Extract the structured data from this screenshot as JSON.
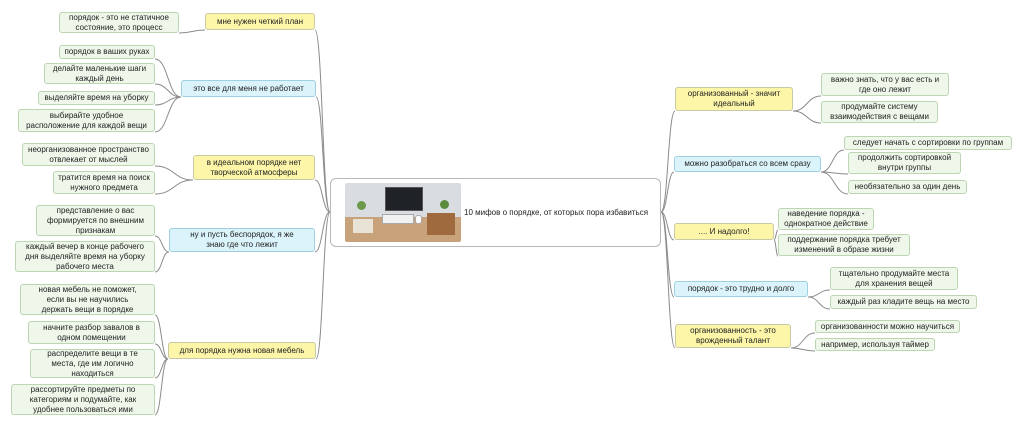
{
  "center": {
    "title": "10 мифов о порядке, от которых пора избавиться",
    "image_icon": "desk-photo"
  },
  "left": [
    {
      "label": "мне нужен четкий план",
      "color": "yellow",
      "children": [
        "порядок - это не статичное\nсостояние, это процесс"
      ]
    },
    {
      "label": "это все для меня не работает",
      "color": "blue",
      "children": [
        "порядок в ваших руках",
        "делайте маленькие шаги\nкаждый день",
        "выделяйте время на уборку",
        "выбирайте удобное\nрасположение для каждой вещи"
      ]
    },
    {
      "label": "в идеальном порядке нет\nтворческой атмосферы",
      "color": "yellow",
      "children": [
        "неорганизованное пространство\nотвлекает от мыслей",
        "тратится время на поиск\nнужного предмета"
      ]
    },
    {
      "label": "ну и пусть беспорядок, я же\nзнаю где что лежит",
      "color": "blue",
      "children": [
        "представление о вас\nформируется по внешним\nпризнакам",
        "каждый вечер в конце рабочего\nдня выделяйте время на уборку\nрабочего места"
      ]
    },
    {
      "label": "для порядка нужна новая мебель",
      "color": "yellow",
      "children": [
        "новая мебель не поможет,\nесли вы не научились\nдержать вещи в порядке",
        "начните разбор завалов в\nодном помещении",
        "распределите вещи в те\nместа, где им логично\nнаходиться",
        "рассортируйте предметы по\nкатегориям и подумайте, как\nудобнее пользоваться ими"
      ]
    }
  ],
  "right": [
    {
      "label": "организованный - значит\nидеальный",
      "color": "yellow",
      "children": [
        "важно знать, что у вас есть и\nгде оно лежит",
        "продумайте систему\nвзаимодействия с вещами"
      ]
    },
    {
      "label": "можно разобраться со всем сразу",
      "color": "blue",
      "children": [
        "следует начать с сортировки по группам",
        "продолжить сортировкой\nвнутри группы",
        "необязательно за один день"
      ]
    },
    {
      "label": ".... И надолго!",
      "color": "yellow",
      "children": [
        "наведение порядка -\nоднократное действие",
        "поддержание порядка требует\nизменений в образе жизни"
      ]
    },
    {
      "label": "порядок - это трудно и долго",
      "color": "blue",
      "children": [
        "тщательно продумайте места\nдля хранения вещей",
        "каждый раз кладите вещь на место"
      ]
    },
    {
      "label": "организованность - это\nврожденный талант",
      "color": "yellow",
      "children": [
        "организованности можно научиться",
        "например, используя таймер"
      ]
    }
  ],
  "colors": {
    "yellow": "#fdf6a8",
    "blue": "#dbf3fb",
    "leaf": "#eef7e9",
    "line": "#8a8a8a"
  }
}
